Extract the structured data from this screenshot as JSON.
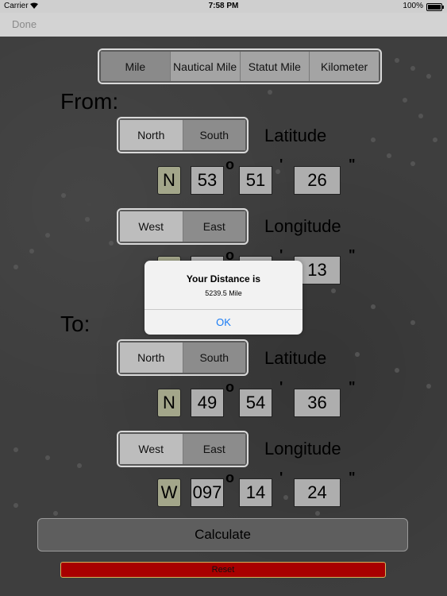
{
  "status": {
    "carrier": "Carrier",
    "time": "7:58 PM",
    "battery": "100%",
    "battery_level": 1.0
  },
  "nav": {
    "done": "Done"
  },
  "units": {
    "items": [
      "Mile",
      "Nautical Mile",
      "Statut Mile",
      "Kilometer"
    ],
    "selected": 0
  },
  "from": {
    "heading": "From:",
    "lat": {
      "options": [
        "North",
        "South"
      ],
      "label": "Latitude",
      "dir": "N",
      "deg": "53",
      "min": "51",
      "sec": "26"
    },
    "lon": {
      "options": [
        "West",
        "East"
      ],
      "label": "Longitude",
      "dir": "",
      "deg": "",
      "min": "",
      "sec": "13"
    }
  },
  "to": {
    "heading": "To:",
    "lat": {
      "options": [
        "North",
        "South"
      ],
      "label": "Latitude",
      "dir": "N",
      "deg": "49",
      "min": "54",
      "sec": "36"
    },
    "lon": {
      "options": [
        "West",
        "East"
      ],
      "label": "Longitude",
      "dir": "W",
      "deg": "097",
      "min": "14",
      "sec": "24"
    }
  },
  "symbols": {
    "deg": "o",
    "min": "'",
    "sec": "\""
  },
  "buttons": {
    "calculate": "Calculate",
    "reset": "Reset"
  },
  "alert": {
    "title": "Your Distance is",
    "message": "5239.5 Mile",
    "ok": "OK"
  },
  "colors": {
    "reset": "#a80000",
    "link": "#1a7cf5"
  }
}
